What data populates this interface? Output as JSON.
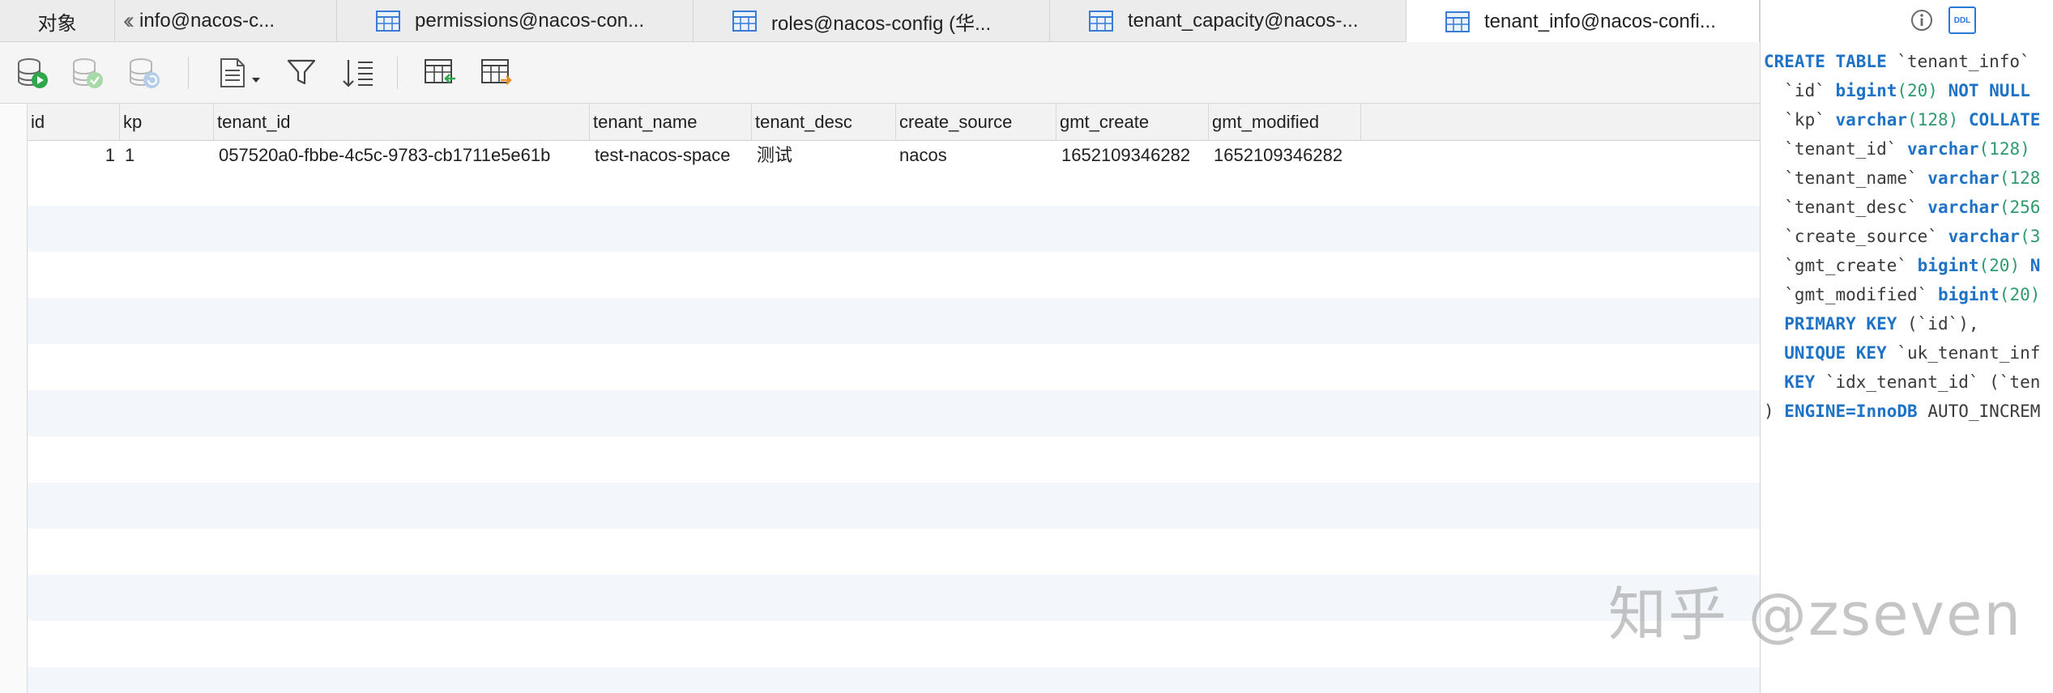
{
  "tabs": {
    "objects_label": "对象",
    "tab1_label": "info@nacos-c...",
    "tab2_label": "permissions@nacos-con...",
    "tab3_label": "roles@nacos-config (华...",
    "tab4_label": "tenant_capacity@nacos-...",
    "tab5_label": "tenant_info@nacos-confi..."
  },
  "ddl_badge": "DDL",
  "grid": {
    "columns": [
      "id",
      "kp",
      "tenant_id",
      "tenant_name",
      "tenant_desc",
      "create_source",
      "gmt_create",
      "gmt_modified"
    ],
    "rows": [
      {
        "id": "1",
        "kp": "1",
        "tenant_id": "057520a0-fbbe-4c5c-9783-cb1711e5e61b",
        "tenant_name": "test-nacos-space",
        "tenant_desc": "测试",
        "create_source": "nacos",
        "gmt_create": "1652109346282",
        "gmt_modified": "1652109346282"
      }
    ]
  },
  "ddl": {
    "l1_kw": "CREATE TABLE",
    "l1_rest": " `tenant_info`",
    "l2_name": "  `id` ",
    "l2_type": "bigint",
    "l2_num": "(20)",
    "l2_kw": " NOT NULL",
    "l3_name": "  `kp` ",
    "l3_type": "varchar",
    "l3_num": "(128)",
    "l3_kw": " COLLATE",
    "l4_name": "  `tenant_id` ",
    "l4_type": "varchar",
    "l4_num": "(128)",
    "l5_name": "  `tenant_name` ",
    "l5_type": "varchar",
    "l5_num": "(128",
    "l6_name": "  `tenant_desc` ",
    "l6_type": "varchar",
    "l6_num": "(256",
    "l7_name": "  `create_source` ",
    "l7_type": "varchar",
    "l7_num": "(3",
    "l8_name": "  `gmt_create` ",
    "l8_type": "bigint",
    "l8_num": "(20)",
    "l8_kw": " N",
    "l9_name": "  `gmt_modified` ",
    "l9_type": "bigint",
    "l9_num": "(20)",
    "l10_kw": "  PRIMARY KEY",
    "l10_rest": " (`id`),",
    "l11_kw": "  UNIQUE KEY",
    "l11_rest": " `uk_tenant_inf",
    "l12_kw": "  KEY",
    "l12_rest": " `idx_tenant_id` (`ten",
    "l13_pre": ") ",
    "l13_kw": "ENGINE=InnoDB",
    "l13_rest": " AUTO_INCREM"
  },
  "watermark": "知乎 @zseven",
  "colors": {
    "accent": "#1f73c7",
    "number": "#2f9a6b",
    "stripe": "#f3f7fb"
  }
}
